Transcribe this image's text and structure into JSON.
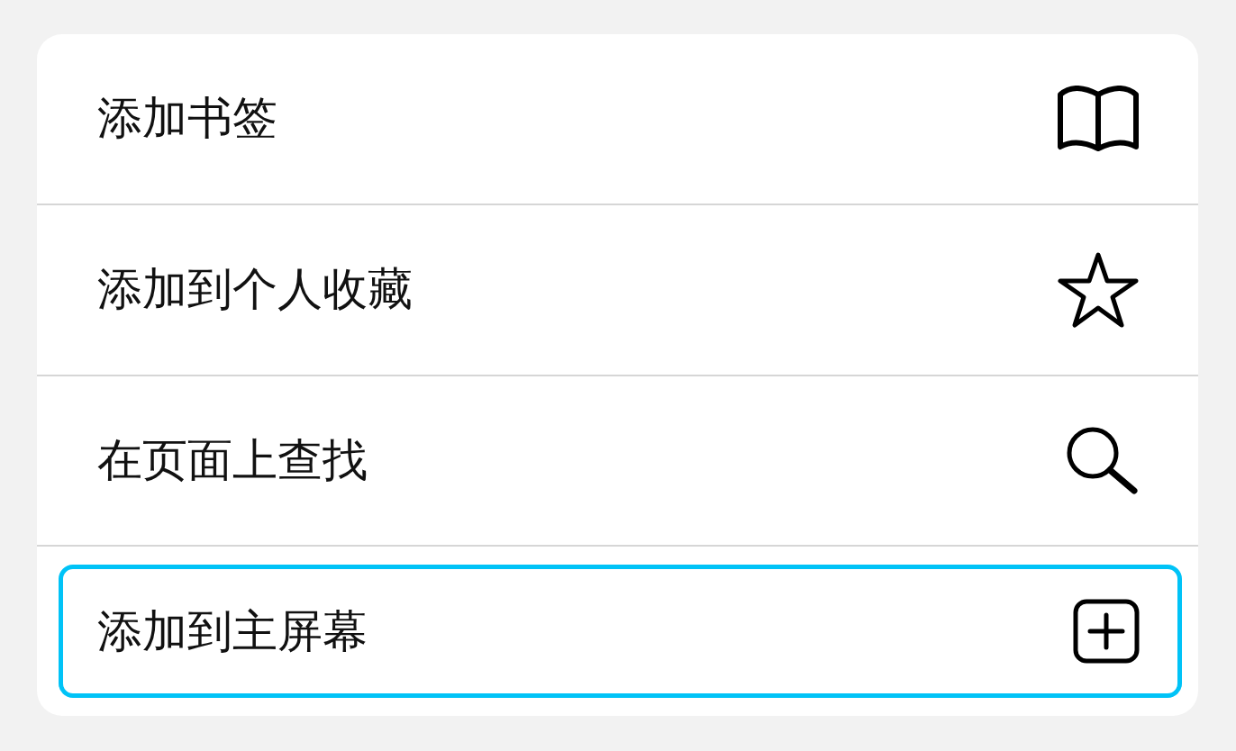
{
  "menu": {
    "items": [
      {
        "label": "添加书签",
        "kind": "book",
        "selected": false
      },
      {
        "label": "添加到个人收藏",
        "kind": "star",
        "selected": false
      },
      {
        "label": "在页面上查找",
        "kind": "search",
        "selected": false
      },
      {
        "label": "添加到主屏幕",
        "kind": "add",
        "selected": true
      }
    ]
  }
}
